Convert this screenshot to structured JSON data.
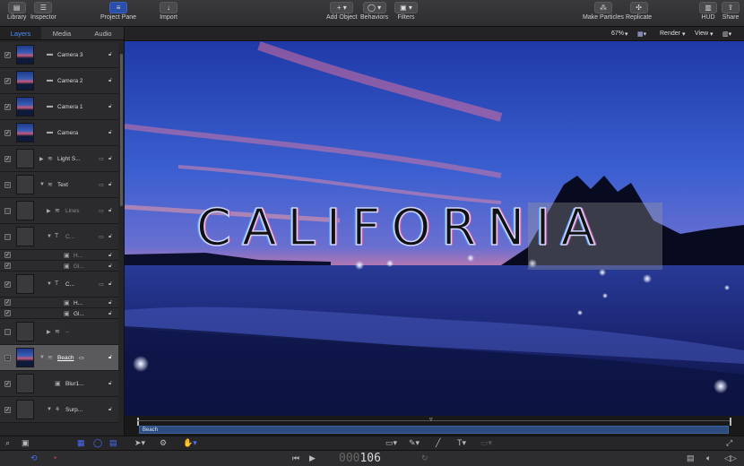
{
  "toolbar": {
    "library": "Library",
    "inspector": "Inspector",
    "project_pane": "Project Pane",
    "import": "Import",
    "add_object": "Add Object",
    "behaviors": "Behaviors",
    "filters": "Filters",
    "make_particles": "Make Particles",
    "replicate": "Replicate",
    "hud": "HUD",
    "share": "Share"
  },
  "panel": {
    "tabs": [
      "Layers",
      "Media",
      "Audio"
    ]
  },
  "layers": [
    {
      "name": "Camera 3"
    },
    {
      "name": "Camera 2"
    },
    {
      "name": "Camera 1"
    },
    {
      "name": "Camera"
    },
    {
      "name": "Light S..."
    },
    {
      "name": "Text"
    },
    {
      "name": "Lines"
    },
    {
      "name": "C..."
    },
    {
      "name": "H..."
    },
    {
      "name": "Gl..."
    },
    {
      "name": "C..."
    },
    {
      "name": "H..."
    },
    {
      "name": "Gl..."
    },
    {
      "name": "--"
    },
    {
      "name": "Beach"
    },
    {
      "name": "Blur1..."
    },
    {
      "name": "Surp..."
    }
  ],
  "viewbar": {
    "zoom": "67%",
    "render": "Render",
    "view": "View"
  },
  "canvas": {
    "title": "CALIFORNIA"
  },
  "timeline": {
    "clip": "Beach"
  },
  "transport": {
    "timecode_prefix": "000",
    "timecode": "106"
  },
  "colors": {
    "accent": "#4c8dff",
    "selected_tool": "#2b4fa8",
    "clip": "#2c4c7e"
  }
}
